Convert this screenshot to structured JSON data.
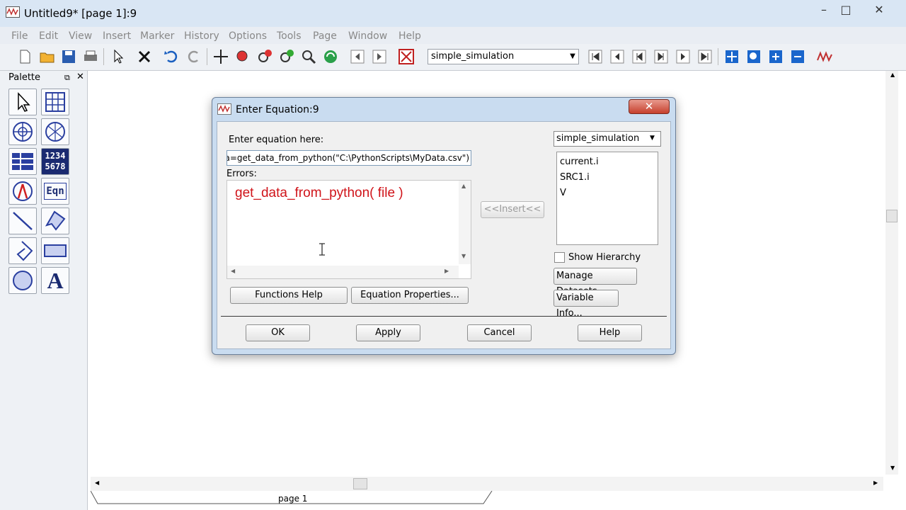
{
  "window": {
    "title": "Untitled9* [page 1]:9",
    "controls": {
      "minimize": "–",
      "maximize": "□",
      "close": "✕"
    }
  },
  "menubar": {
    "items": [
      "File",
      "Edit",
      "View",
      "Insert",
      "Marker",
      "History",
      "Options",
      "Tools",
      "Page",
      "Window",
      "Help"
    ]
  },
  "toolbar": {
    "dataset_select": "simple_simulation"
  },
  "palette": {
    "title": "Palette",
    "numeric_tile": [
      "1234",
      "5678"
    ],
    "eqn_tile": "Eqn",
    "text_tile": "A"
  },
  "canvas": {
    "page_tab": "page 1"
  },
  "dialog": {
    "title": "Enter Equation:9",
    "close_label": "✕",
    "equation_label": "Enter equation here:",
    "equation_value": "data=get_data_from_python(\"C:\\PythonScripts\\MyData.csv\")",
    "errors_label": "Errors:",
    "error_text": "get_data_from_python( file )",
    "insert_button": "<<Insert<<",
    "functions_help": "Functions Help",
    "equation_properties": "Equation Properties...",
    "dataset_select": "simple_simulation",
    "variables": [
      "current.i",
      "SRC1.i",
      "V"
    ],
    "show_hierarchy": "Show Hierarchy",
    "manage_datasets": "Manage Datasets...",
    "variable_info": "Variable Info...",
    "ok": "OK",
    "apply": "Apply",
    "cancel": "Cancel",
    "help": "Help"
  },
  "colors": {
    "error_text": "#d0141a",
    "dialog_frame": "#c9dcf0",
    "close_button": "#c6402d"
  }
}
